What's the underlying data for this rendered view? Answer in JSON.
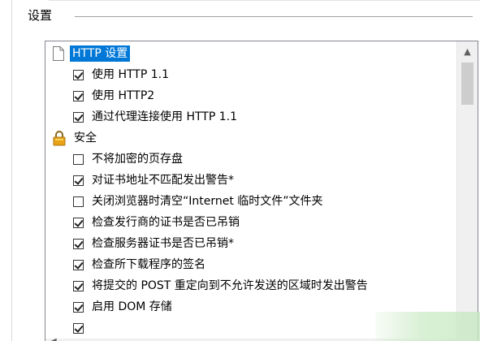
{
  "settings": {
    "group_label": "设置",
    "tree": {
      "categories": [
        {
          "label": "HTTP 设置",
          "icon": "page-icon",
          "selected": true,
          "options": [
            {
              "label": "使用 HTTP 1.1",
              "checked": true
            },
            {
              "label": "使用 HTTP2",
              "checked": true
            },
            {
              "label": "通过代理连接使用 HTTP 1.1",
              "checked": true
            }
          ]
        },
        {
          "label": "安全",
          "icon": "lock-icon",
          "selected": false,
          "options": [
            {
              "label": "不将加密的页存盘",
              "checked": false
            },
            {
              "label": "对证书地址不匹配发出警告*",
              "checked": true
            },
            {
              "label": "关闭浏览器时清空“Internet 临时文件”文件夹",
              "checked": false
            },
            {
              "label": "检查发行商的证书是否已吊销",
              "checked": true
            },
            {
              "label": "检查服务器证书是否已吊销*",
              "checked": true
            },
            {
              "label": "检查所下载程序的签名",
              "checked": true
            },
            {
              "label": "将提交的 POST 重定向到不允许发送的区域时发出警告",
              "checked": true
            },
            {
              "label": "启用 DOM 存储",
              "checked": true
            }
          ]
        }
      ]
    },
    "colors": {
      "selection": "#0078d7",
      "lock_gold": "#e8a317"
    }
  }
}
